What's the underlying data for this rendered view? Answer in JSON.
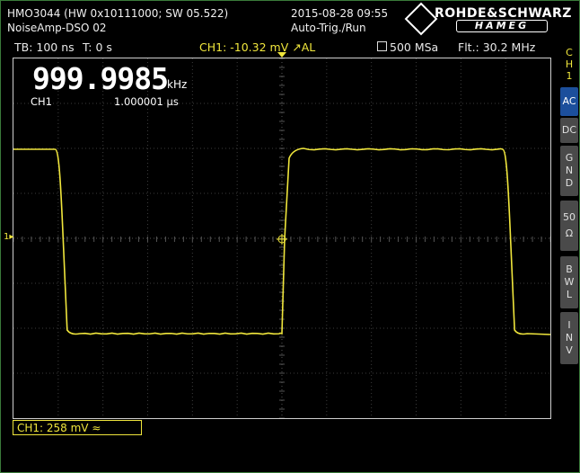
{
  "header": {
    "device": "HMO3044 (HW 0x10111000; SW 05.522)",
    "name": "NoiseAmp-DSO 02",
    "datetime": "2015-08-28 09:55",
    "trigger_mode": "Auto-Trig./Run",
    "brand_top": "ROHDE&SCHWARZ",
    "brand_bottom": "HAMEG"
  },
  "status_bar": {
    "timebase": "TB: 100 ns",
    "t_offset": "T: 0 s",
    "trigger": "CH1: -10.32 mV ↗AL",
    "sample_rate": "500 MSa",
    "filter": "Flt.: 30.2 MHz"
  },
  "measurement": {
    "frequency": "999.9985",
    "frequency_unit": "kHz",
    "channel": "CH1",
    "period": "1.000001 µs"
  },
  "channel_box": "CH1: 258 mV ≈",
  "side_menu": {
    "title_lines": [
      "C",
      "H",
      "1"
    ],
    "buttons": [
      {
        "lines": [
          "AC"
        ],
        "active": true
      },
      {
        "lines": [
          "DC"
        ],
        "active": false
      },
      {
        "lines": [
          "G",
          "N",
          "D"
        ],
        "active": false
      },
      {
        "lines": [
          "50",
          "Ω"
        ],
        "active": false
      },
      {
        "lines": [
          "B",
          "W",
          "L"
        ],
        "active": false
      },
      {
        "lines": [
          "I",
          "N",
          "V"
        ],
        "active": false
      }
    ]
  },
  "markers": {
    "ch1_ground": "1"
  },
  "colors": {
    "trace": "#f0e63c",
    "grid": "#3c3c3c",
    "active_button": "#1c4f9c"
  },
  "waveform": {
    "type": "square",
    "duty_time_units": "100 ns/div",
    "levels": {
      "high": 2.0,
      "low": -2.1
    },
    "edges": [
      {
        "t": -4.95,
        "dir": "fall"
      },
      {
        "t": 0.0,
        "dir": "rise"
      },
      {
        "t": 5.05,
        "dir": "fall"
      }
    ],
    "divisions": {
      "x": 12,
      "y": 8
    }
  }
}
